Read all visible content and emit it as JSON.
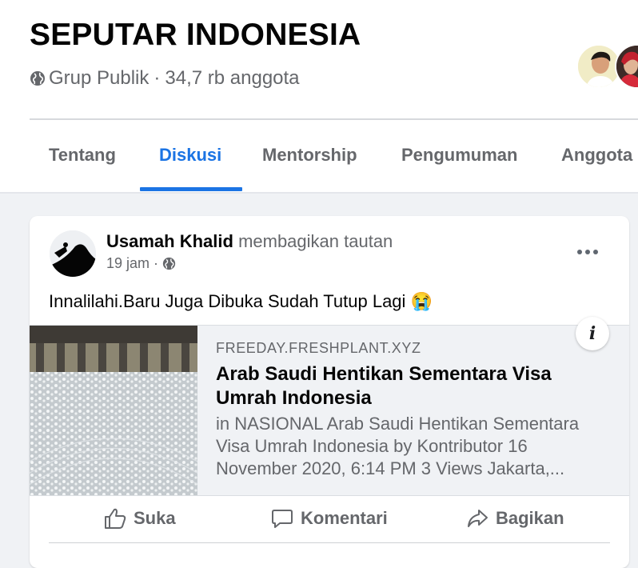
{
  "group": {
    "name": "SEPUTAR INDONESIA",
    "privacy": "Grup Publik",
    "separator": "·",
    "members": "34,7 rb anggota"
  },
  "tabs": [
    {
      "label": "Tentang",
      "active": false
    },
    {
      "label": "Diskusi",
      "active": true
    },
    {
      "label": "Mentorship",
      "active": false
    },
    {
      "label": "Pengumuman",
      "active": false
    },
    {
      "label": "Anggota",
      "active": false
    }
  ],
  "post": {
    "author": "Usamah Khalid",
    "action": "membagikan tautan",
    "time": "19 jam",
    "separator": "·",
    "text": "Innalilahi.Baru Juga Dibuka Sudah Tutup Lagi",
    "emoji": "😭",
    "link": {
      "domain": "FREEDAY.FRESHPLANT.XYZ",
      "title": "Arab Saudi Hentikan Sementara Visa Umrah Indonesia",
      "description": "in NASIONAL Arab Saudi Hentikan Sementara Visa Umrah Indonesia by Kontributor 16 November 2020, 6:14 PM 3 Views Jakarta,...",
      "info_label": "i"
    },
    "actions": {
      "like": "Suka",
      "comment": "Komentari",
      "share": "Bagikan"
    }
  },
  "colors": {
    "accent": "#1b74e4",
    "text_primary": "#050505",
    "text_secondary": "#65676b",
    "background": "#f0f2f5"
  },
  "icons": [
    "globe-icon",
    "more-icon",
    "info-icon",
    "like-icon",
    "comment-icon",
    "share-icon"
  ]
}
